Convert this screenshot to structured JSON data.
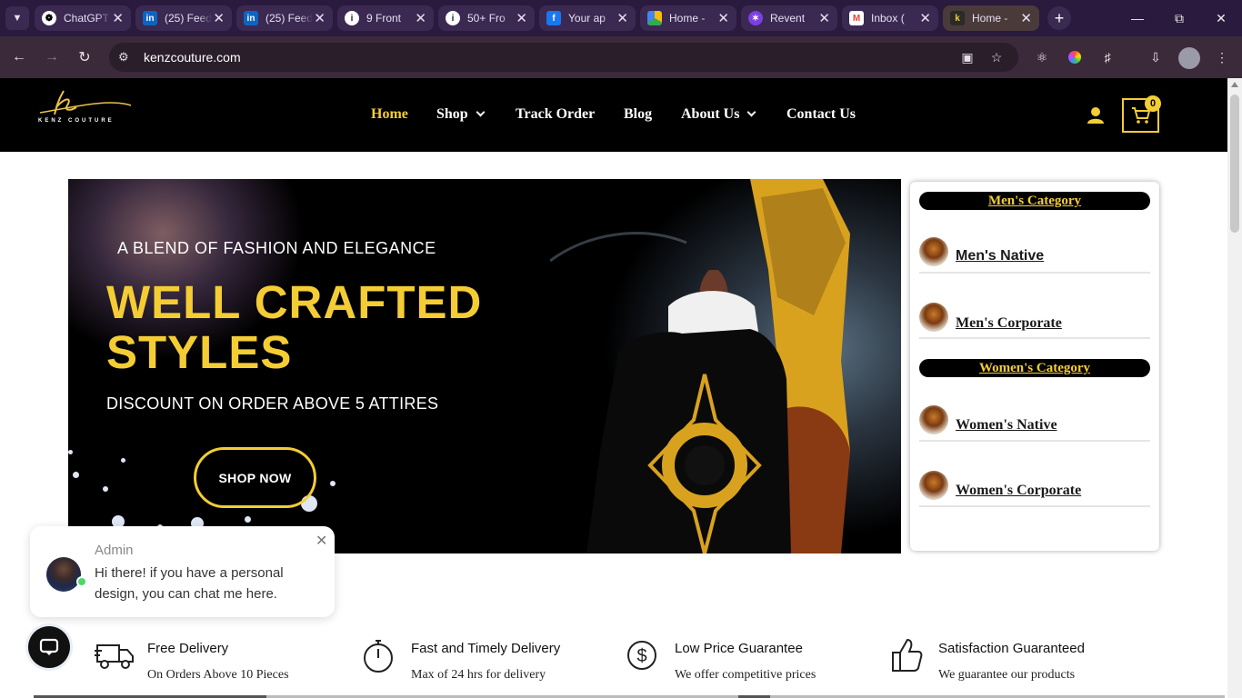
{
  "browser": {
    "tabs": [
      {
        "title": "ChatGPT",
        "favicon": "chatgpt-icon",
        "active": false
      },
      {
        "title": "(25) Feed",
        "favicon": "linkedin-icon",
        "active": false
      },
      {
        "title": "(25) Feed",
        "favicon": "linkedin-icon",
        "active": false
      },
      {
        "title": "9 Front",
        "favicon": "info-icon",
        "active": false
      },
      {
        "title": "50+ Fro",
        "favicon": "info-icon",
        "active": false
      },
      {
        "title": "Your ap",
        "favicon": "f-icon",
        "active": false
      },
      {
        "title": "Home -",
        "favicon": "drive-icon",
        "active": false
      },
      {
        "title": "Revent",
        "favicon": "revent-icon",
        "active": false
      },
      {
        "title": "Inbox (",
        "favicon": "gmail-icon",
        "active": false
      },
      {
        "title": "Home -",
        "favicon": "kenz-icon",
        "active": true
      }
    ],
    "url": "kenzcouture.com"
  },
  "site": {
    "logo_text": "KENZ COUTURE",
    "logo_letter": "k",
    "nav": {
      "home": "Home",
      "shop": "Shop",
      "track": "Track Order",
      "blog": "Blog",
      "about": "About Us",
      "contact": "Contact Us"
    },
    "cart_count": "0",
    "accent": "#f4cd35"
  },
  "hero": {
    "tagline": "A BLEND OF FASHION AND ELEGANCE",
    "title_line1": "WELL CRAFTED",
    "title_line2": "STYLES",
    "subtitle": "DISCOUNT ON ORDER ABOVE 5 ATTIRES",
    "button": "SHOP NOW"
  },
  "categories": {
    "men_heading": "Men's Category",
    "men_items": [
      "Men's Native",
      "Men's Corporate"
    ],
    "women_heading": "Women's Category",
    "women_items": [
      "Women's Native",
      "Women's Corporate"
    ]
  },
  "chat": {
    "name": "Admin",
    "message": "Hi there! if you have a personal design, you can chat me here."
  },
  "features": [
    {
      "title": "Free Delivery",
      "desc": "On Orders Above 10 Pieces",
      "icon": "truck-icon"
    },
    {
      "title": "Fast and Timely Delivery",
      "desc": "Max of 24 hrs for delivery",
      "icon": "stopwatch-icon"
    },
    {
      "title": "Low Price Guarantee",
      "desc": "We offer competitive prices",
      "icon": "dollar-icon"
    },
    {
      "title": "Satisfaction Guaranteed",
      "desc": "We guarantee our products",
      "icon": "thumbs-up-icon"
    }
  ]
}
